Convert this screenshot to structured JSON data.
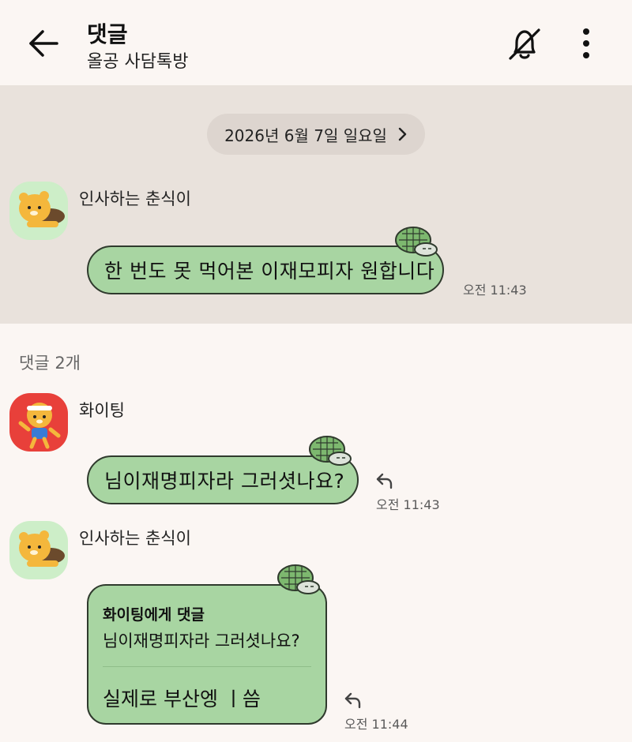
{
  "header": {
    "title": "댓글",
    "subtitle": "올공 사담톡방",
    "back_icon": "arrow-left-icon",
    "mute_icon": "bell-off-icon",
    "more_icon": "more-vertical-icon"
  },
  "post": {
    "date_label": "2026년 6월 7일 일요일",
    "sender": "인사하는 춘식이",
    "message": "한 번도 못 먹어본 이재모피자 원합니다",
    "time": "오전 11:43"
  },
  "comments_count": "댓글 2개",
  "comments": [
    {
      "sender": "화이팅",
      "message": "님이재명피자라 그러셧나요?",
      "time": "오전 11:43"
    },
    {
      "sender": "인사하는 춘식이",
      "quote_name": "화이팅에게 댓글",
      "quote_text": "님이재명피자라 그러셧나요?",
      "message": "실제로 부산엥 ㅣ씀",
      "time": "오전 11:44"
    }
  ],
  "colors": {
    "bubble": "#a8d5a2",
    "background": "#fbf6f3",
    "post_background": "#e9e2dc"
  }
}
